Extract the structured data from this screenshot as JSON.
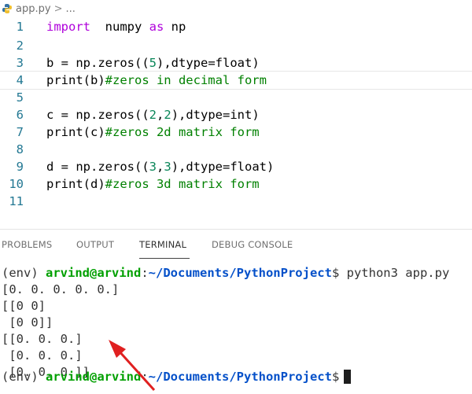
{
  "breadcrumb": {
    "file": "app.py",
    "chevron": ">",
    "ellipsis": "..."
  },
  "editor": {
    "lines": [
      {
        "n": "1",
        "tokens": [
          [
            "kw",
            "import"
          ],
          [
            "",
            "  numpy "
          ],
          [
            "kw",
            "as"
          ],
          [
            "",
            " np"
          ]
        ]
      },
      {
        "n": "2",
        "tokens": []
      },
      {
        "n": "3",
        "tokens": [
          [
            "",
            "b = np.zeros(("
          ],
          [
            "num",
            "5"
          ],
          [
            "",
            "),dtype=float)"
          ]
        ]
      },
      {
        "n": "4",
        "tokens": [
          [
            "",
            "print(b)"
          ],
          [
            "cmt",
            "#zeros in decimal form"
          ]
        ],
        "current": true
      },
      {
        "n": "5",
        "tokens": []
      },
      {
        "n": "6",
        "tokens": [
          [
            "",
            "c = np.zeros(("
          ],
          [
            "num",
            "2"
          ],
          [
            "",
            ","
          ],
          [
            "num",
            "2"
          ],
          [
            "",
            "),dtype=int)"
          ]
        ]
      },
      {
        "n": "7",
        "tokens": [
          [
            "",
            "print(c)"
          ],
          [
            "cmt",
            "#zeros 2d matrix form"
          ]
        ]
      },
      {
        "n": "8",
        "tokens": []
      },
      {
        "n": "9",
        "tokens": [
          [
            "",
            "d = np.zeros(("
          ],
          [
            "num",
            "3"
          ],
          [
            "",
            ","
          ],
          [
            "num",
            "3"
          ],
          [
            "",
            "),dtype=float)"
          ]
        ]
      },
      {
        "n": "10",
        "tokens": [
          [
            "",
            "print(d)"
          ],
          [
            "cmt",
            "#zeros 3d matrix form"
          ]
        ]
      },
      {
        "n": "11",
        "tokens": []
      }
    ]
  },
  "panel": {
    "tabs": [
      {
        "label": "PROBLEMS",
        "active": false
      },
      {
        "label": "OUTPUT",
        "active": false
      },
      {
        "label": "TERMINAL",
        "active": true
      },
      {
        "label": "DEBUG CONSOLE",
        "active": false
      }
    ]
  },
  "terminal": {
    "env": "(env) ",
    "user": "arvind@arvind",
    "colon": ":",
    "path": "~/Documents/PythonProject",
    "prompt_char": "$",
    "command": " python3 app.py",
    "output": [
      "[0. 0. 0. 0. 0.]",
      "[[0 0]",
      " [0 0]]",
      "[[0. 0. 0.]",
      " [0. 0. 0.]",
      " [0. 0. 0.]]"
    ]
  },
  "colors": {
    "annotation_arrow": "#e02020",
    "keyword": "#af00db",
    "number": "#098658",
    "comment": "#008000",
    "line_number": "#237893"
  }
}
